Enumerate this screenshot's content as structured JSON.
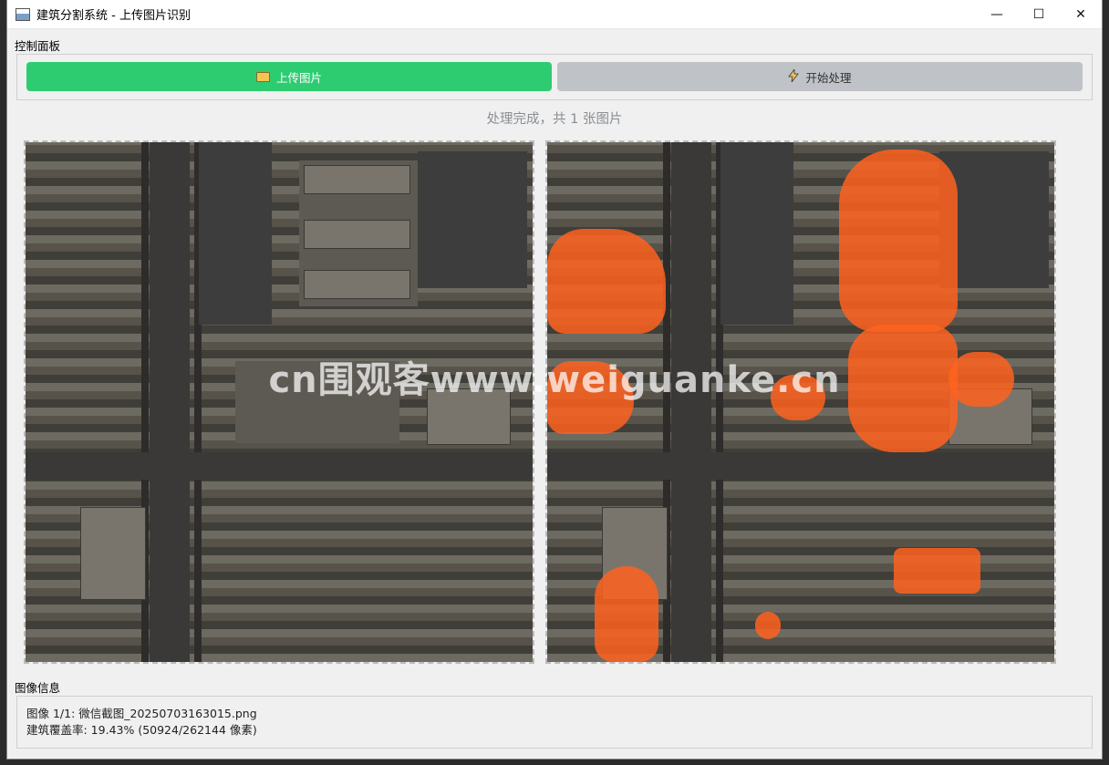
{
  "window": {
    "title": "建筑分割系统 - 上传图片识别",
    "controls": {
      "minimize": "—",
      "maximize": "☐",
      "close": "✕"
    }
  },
  "control_panel": {
    "label": "控制面板",
    "upload_button": "上传图片",
    "process_button": "开始处理"
  },
  "status_text": "处理完成，共 1 张图片",
  "images": {
    "original_name": "original-aerial-image",
    "result_name": "segmentation-result-image"
  },
  "watermark": "cn围观客www.weiguanke.cn",
  "info": {
    "label": "图像信息",
    "line1": "图像 1/1: 微信截图_20250703163015.png",
    "line2": "建筑覆盖率: 19.43% (50924/262144 像素)",
    "coverage_percent": 19.43,
    "building_pixels": 50924,
    "total_pixels": 262144
  },
  "colors": {
    "upload_button": "#2ecc71",
    "process_button": "#bfc3c7",
    "mask": "#ff621e",
    "status_text": "#8a8f94"
  }
}
